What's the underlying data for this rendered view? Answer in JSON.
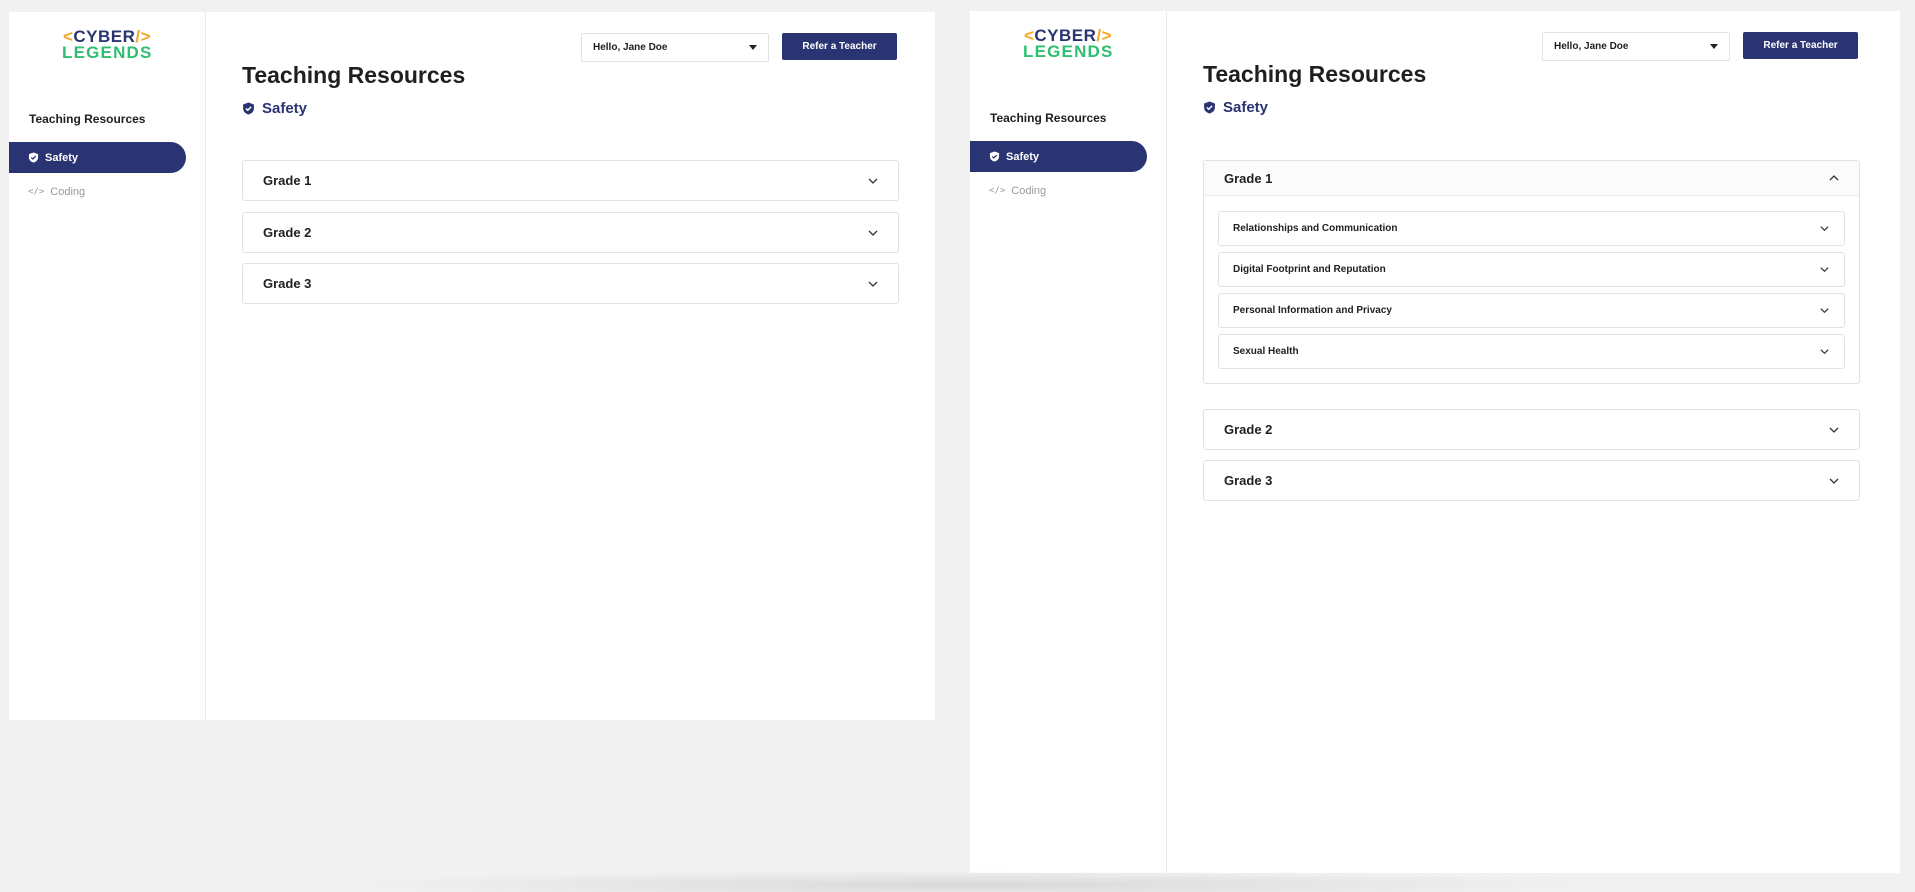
{
  "logo": {
    "bracket_open": "<",
    "line1": "CYBER",
    "bracket_close": "/>",
    "line2": "LEGENDS"
  },
  "sidebar": {
    "heading": "Teaching Resources",
    "items": [
      {
        "label": "Safety",
        "icon": "shield-check-icon",
        "active": true
      },
      {
        "label": "Coding",
        "icon": "code-icon",
        "active": false
      }
    ]
  },
  "header": {
    "user_greeting": "Hello, Jane Doe",
    "refer_button": "Refer a Teacher"
  },
  "page": {
    "title": "Teaching Resources",
    "section": "Safety"
  },
  "screens": [
    {
      "grades": [
        {
          "label": "Grade 1",
          "expanded": false
        },
        {
          "label": "Grade 2",
          "expanded": false
        },
        {
          "label": "Grade 3",
          "expanded": false
        }
      ]
    },
    {
      "grades": [
        {
          "label": "Grade 1",
          "expanded": true,
          "topics": [
            "Relationships and Communication",
            "Digital Footprint and Reputation",
            "Personal Information and Privacy",
            "Sexual Health"
          ]
        },
        {
          "label": "Grade 2",
          "expanded": false
        },
        {
          "label": "Grade 3",
          "expanded": false
        }
      ]
    }
  ],
  "colors": {
    "primary": "#2a3473",
    "logo_orange": "#f5a623",
    "logo_green": "#2fbf71",
    "muted": "#9a9a9a"
  }
}
